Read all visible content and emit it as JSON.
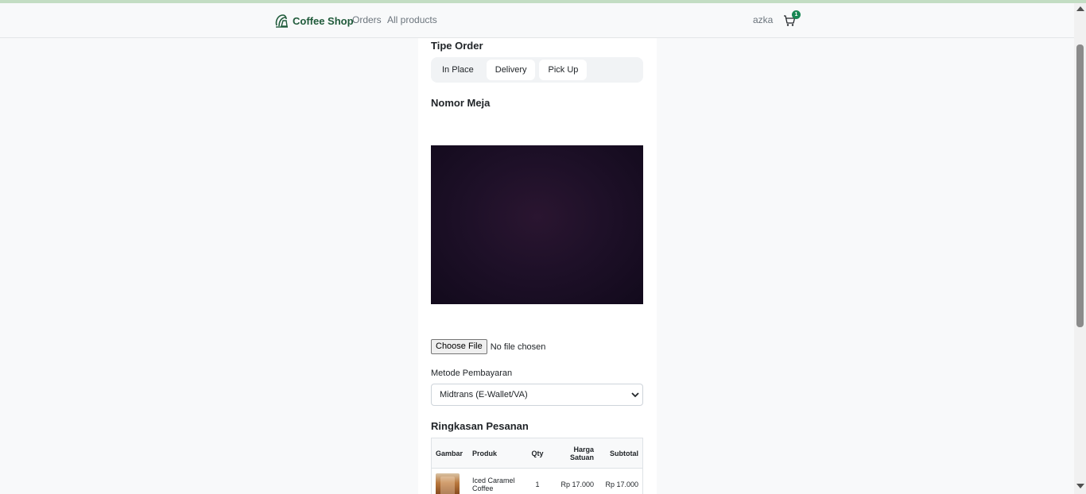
{
  "navbar": {
    "brand": "Coffee Shop",
    "links": [
      "Orders",
      "All products"
    ],
    "user": "azka",
    "cart_count": "1"
  },
  "order_type": {
    "title": "Tipe Order",
    "tabs": [
      "In Place",
      "Delivery",
      "Pick Up"
    ],
    "active": "In Place"
  },
  "table_number": {
    "title": "Nomor Meja"
  },
  "file_input": {
    "button": "Choose File",
    "status": "No file chosen"
  },
  "payment": {
    "label": "Metode Pembayaran",
    "selected": "Midtrans (E-Wallet/VA)"
  },
  "summary": {
    "title": "Ringkasan Pesanan",
    "headers": [
      "Gambar",
      "Produk",
      "Qty",
      "Harga Satuan",
      "Subtotal"
    ],
    "rows": [
      {
        "product": "Iced Caramel Coffee",
        "qty": "1",
        "price": "Rp 17.000",
        "subtotal": "Rp 17.000"
      }
    ]
  },
  "colors": {
    "brand": "#1f5a3a",
    "badge": "#198754",
    "background": "#f8f9fa"
  }
}
